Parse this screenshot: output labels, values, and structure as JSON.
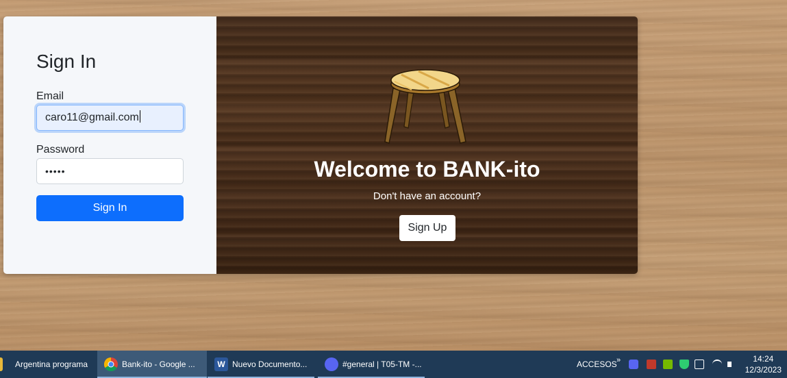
{
  "signin": {
    "title": "Sign In",
    "email_label": "Email",
    "email_value": "caro11@gmail.com",
    "password_label": "Password",
    "password_value": "•••••",
    "submit_label": "Sign In"
  },
  "welcome": {
    "heading": "Welcome to BANK-ito",
    "prompt": "Don't have an account?",
    "signup_label": "Sign Up"
  },
  "taskbar": {
    "items": [
      {
        "label": "Argentina programa",
        "icon": "folder-icon"
      },
      {
        "label": "Bank-ito - Google ...",
        "icon": "chrome-icon"
      },
      {
        "label": "Nuevo Documento...",
        "icon": "word-icon"
      },
      {
        "label": "#general | T05-TM -...",
        "icon": "discord-icon"
      }
    ],
    "tray_label": "ACCESOS",
    "time": "14:24",
    "date": "12/3/2023"
  },
  "colors": {
    "primary_button": "#0d6efd",
    "taskbar": "#1f3a56"
  }
}
